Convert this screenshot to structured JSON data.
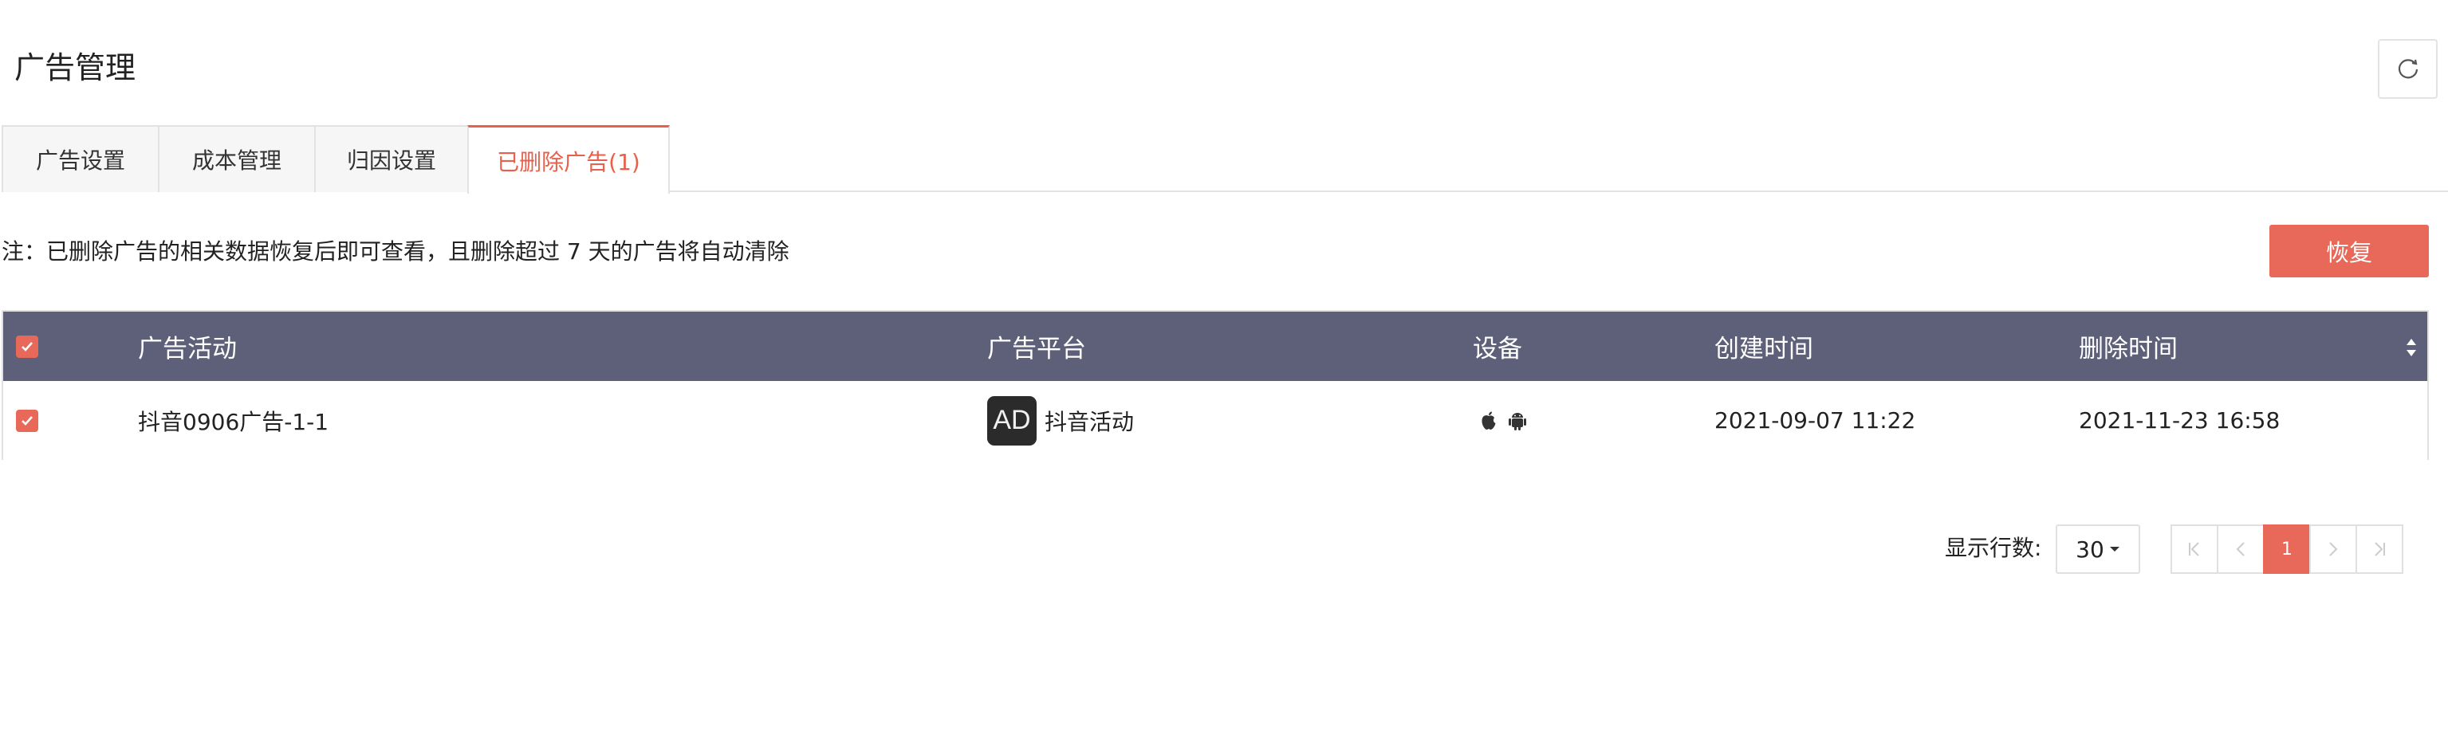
{
  "header": {
    "title": "广告管理",
    "refresh_icon": "refresh-icon"
  },
  "tabs": [
    {
      "label": "广告设置",
      "active": false
    },
    {
      "label": "成本管理",
      "active": false
    },
    {
      "label": "归因设置",
      "active": false
    },
    {
      "label": "已删除广告(1)",
      "active": true
    }
  ],
  "note": "注：已删除广告的相关数据恢复后即可查看，且删除超过 7 天的广告将自动清除",
  "restore_label": "恢复",
  "colors": {
    "accent": "#e8604c",
    "header_bg": "#5e5f78"
  },
  "table": {
    "columns": [
      "广告活动",
      "广告平台",
      "设备",
      "创建时间",
      "删除时间"
    ],
    "rows": [
      {
        "checked": true,
        "campaign": "抖音0906广告-1-1",
        "platform_logo": "AD",
        "platform": "抖音活动",
        "devices": [
          "apple-icon",
          "android-icon"
        ],
        "created": "2021-09-07 11:22",
        "deleted": "2021-11-23 16:58"
      }
    ]
  },
  "pagination": {
    "rows_label": "显示行数:",
    "rows_value": "30",
    "current_page": "1"
  }
}
